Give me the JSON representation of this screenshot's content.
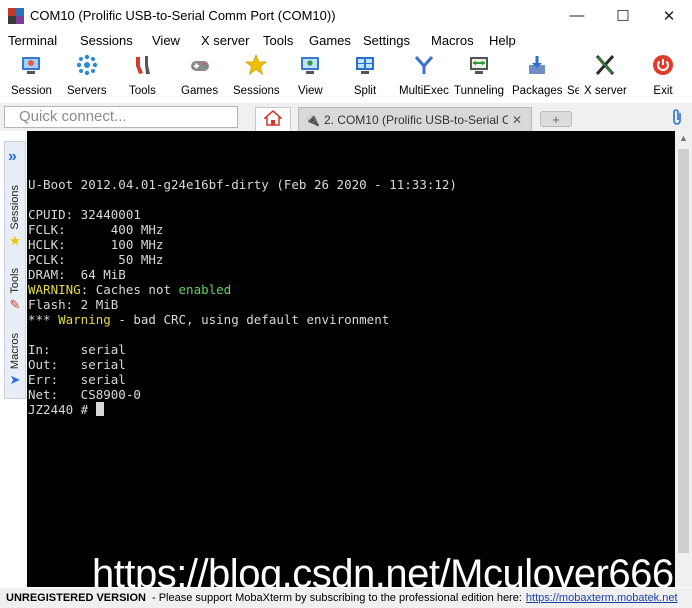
{
  "window": {
    "title": "COM10  (Prolific USB-to-Serial Comm Port (COM10))",
    "minimize_glyph": "—",
    "maximize_glyph": "☐",
    "close_glyph": "✕"
  },
  "menu": [
    "Terminal",
    "Sessions",
    "View",
    "X server",
    "Tools",
    "Games",
    "Settings",
    "Macros",
    "Help"
  ],
  "toolbar": [
    {
      "label": "Session",
      "icon": "session-icon"
    },
    {
      "label": "Servers",
      "icon": "servers-icon"
    },
    {
      "label": "Tools",
      "icon": "tools-icon"
    },
    {
      "label": "Games",
      "icon": "games-icon"
    },
    {
      "label": "Sessions",
      "icon": "star-icon"
    },
    {
      "label": "View",
      "icon": "view-icon"
    },
    {
      "label": "Split",
      "icon": "split-icon"
    },
    {
      "label": "MultiExec",
      "icon": "multiexec-icon"
    },
    {
      "label": "Tunneling",
      "icon": "tunneling-icon"
    },
    {
      "label": "Packages",
      "icon": "packages-icon"
    },
    {
      "label": "Se",
      "icon": "settings-icon"
    },
    {
      "label": "X server",
      "icon": "x-server-icon"
    },
    {
      "label": "Exit",
      "icon": "power-icon"
    }
  ],
  "quick_connect": {
    "placeholder": "Quick connect..."
  },
  "tabs": {
    "active_label": "2. COM10  (Prolific USB-to-Serial C",
    "close_glyph": "✕",
    "new_tab_glyph": "+"
  },
  "sidebar": {
    "tabs": [
      "Sessions",
      "Tools",
      "Macros"
    ]
  },
  "terminal": {
    "lines": [
      {
        "text": ""
      },
      {
        "text": "U-Boot 2012.04.01-g24e16bf-dirty (Feb 26 2020 - 11:33:12)"
      },
      {
        "text": ""
      },
      {
        "text": "CPUID: 32440001"
      },
      {
        "text": "FCLK:      400 MHz"
      },
      {
        "text": "HCLK:      100 MHz"
      },
      {
        "text": "PCLK:       50 MHz"
      },
      {
        "text": "DRAM:  64 MiB"
      },
      {
        "segments": [
          {
            "text": "WARNING",
            "color": "yellow"
          },
          {
            "text": ": Caches not "
          },
          {
            "text": "enabled",
            "color": "green"
          }
        ]
      },
      {
        "text": "Flash: 2 MiB"
      },
      {
        "segments": [
          {
            "text": "*** "
          },
          {
            "text": "Warning",
            "color": "yellow"
          },
          {
            "text": " - bad CRC, using default environment"
          }
        ]
      },
      {
        "text": ""
      },
      {
        "text": "In:    serial"
      },
      {
        "text": "Out:   serial"
      },
      {
        "text": "Err:   serial"
      },
      {
        "text": "Net:   CS8900-0"
      },
      {
        "text": "JZ2440 # ",
        "cursor": true
      }
    ],
    "colors": {
      "yellow": "#e6db3a",
      "green": "#5fd35f",
      "text": "#d8d8d8",
      "background": "#000000"
    }
  },
  "watermark": "https://blog.csdn.net/Mculover666",
  "status": {
    "strong": "UNREGISTERED VERSION",
    "text": " -  Please support MobaXterm by subscribing to the professional edition here:",
    "link": "https://mobaxterm.mobatek.net"
  }
}
